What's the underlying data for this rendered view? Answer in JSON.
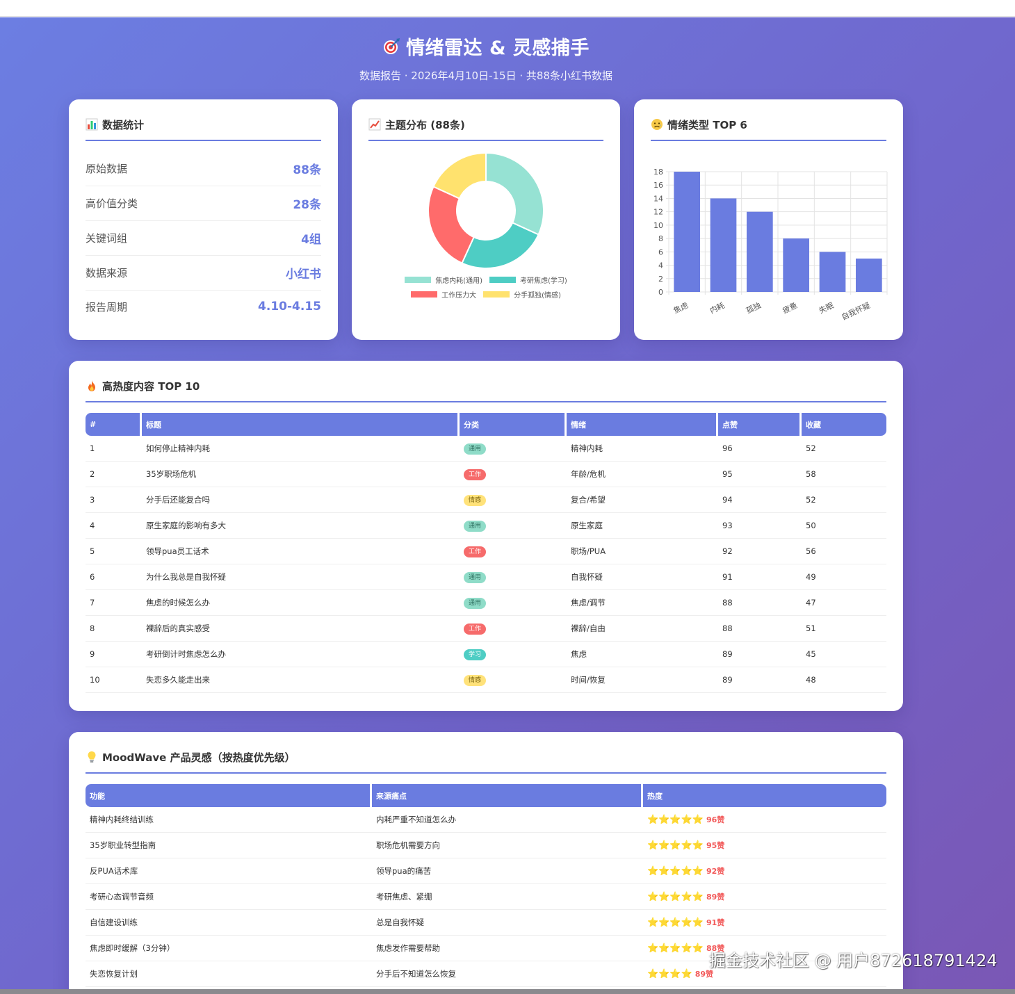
{
  "header": {
    "title": "情绪雷达 & 灵感捕手",
    "subtitle": "数据报告 · 2026年4月10日-15日 · 共88条小红书数据"
  },
  "stats_card": {
    "title": "数据统计",
    "rows": [
      {
        "label": "原始数据",
        "value": "88条"
      },
      {
        "label": "高价值分类",
        "value": "28条"
      },
      {
        "label": "关键词组",
        "value": "4组"
      },
      {
        "label": "数据来源",
        "value": "小红书"
      },
      {
        "label": "报告周期",
        "value": "4.10-4.15"
      }
    ]
  },
  "topic_card": {
    "title": "主题分布 (88条)"
  },
  "emotion_card": {
    "title": "情绪类型 TOP 6"
  },
  "chart_data": [
    {
      "type": "pie",
      "title": "",
      "donut": true,
      "categories": [
        "焦虑内耗(通用)",
        "考研焦虑(学习)",
        "工作压力大",
        "分手孤独(情感)"
      ],
      "values": [
        28,
        22,
        22,
        16
      ],
      "colors": [
        "#96e2d3",
        "#4ecdc4",
        "#ff6b6b",
        "#ffe26e"
      ],
      "legend": "bottom"
    },
    {
      "type": "bar",
      "title": "",
      "categories": [
        "焦虑",
        "内耗",
        "孤独",
        "疲惫",
        "失眠",
        "自我怀疑"
      ],
      "values": [
        18,
        14,
        12,
        8,
        6,
        5
      ],
      "ylim": [
        0,
        18
      ],
      "yticks": [
        0,
        2,
        4,
        6,
        8,
        10,
        12,
        14,
        16,
        18
      ],
      "grid": true,
      "color": "#6a7ce0",
      "xlabel": "",
      "ylabel": ""
    }
  ],
  "hot_card": {
    "title": "高热度内容 TOP 10",
    "columns": [
      "#",
      "标题",
      "分类",
      "情绪",
      "点赞",
      "收藏"
    ],
    "rows": [
      {
        "rank": "1",
        "title": "如何停止精神内耗",
        "cat": "通用",
        "cat_type": "general",
        "emotion": "精神内耗",
        "likes": "96",
        "saves": "52"
      },
      {
        "rank": "2",
        "title": "35岁职场危机",
        "cat": "工作",
        "cat_type": "work",
        "emotion": "年龄/危机",
        "likes": "95",
        "saves": "58"
      },
      {
        "rank": "3",
        "title": "分手后还能复合吗",
        "cat": "情感",
        "cat_type": "emotion",
        "emotion": "复合/希望",
        "likes": "94",
        "saves": "52"
      },
      {
        "rank": "4",
        "title": "原生家庭的影响有多大",
        "cat": "通用",
        "cat_type": "general",
        "emotion": "原生家庭",
        "likes": "93",
        "saves": "50"
      },
      {
        "rank": "5",
        "title": "领导pua员工话术",
        "cat": "工作",
        "cat_type": "work",
        "emotion": "职场/PUA",
        "likes": "92",
        "saves": "56"
      },
      {
        "rank": "6",
        "title": "为什么我总是自我怀疑",
        "cat": "通用",
        "cat_type": "general",
        "emotion": "自我怀疑",
        "likes": "91",
        "saves": "49"
      },
      {
        "rank": "7",
        "title": "焦虑的时候怎么办",
        "cat": "通用",
        "cat_type": "general",
        "emotion": "焦虑/调节",
        "likes": "88",
        "saves": "47"
      },
      {
        "rank": "8",
        "title": "裸辞后的真实感受",
        "cat": "工作",
        "cat_type": "work",
        "emotion": "裸辞/自由",
        "likes": "88",
        "saves": "51"
      },
      {
        "rank": "9",
        "title": "考研倒计时焦虑怎么办",
        "cat": "学习",
        "cat_type": "study",
        "emotion": "焦虑",
        "likes": "89",
        "saves": "45"
      },
      {
        "rank": "10",
        "title": "失恋多久能走出来",
        "cat": "情感",
        "cat_type": "emotion",
        "emotion": "时间/恢复",
        "likes": "89",
        "saves": "48"
      }
    ]
  },
  "idea_card": {
    "title": "MoodWave 产品灵感（按热度优先级）",
    "columns": [
      "功能",
      "来源痛点",
      "热度"
    ],
    "rows": [
      {
        "feature": "精神内耗终结训练",
        "pain": "内耗严重不知道怎么办",
        "stars": "⭐⭐⭐⭐⭐",
        "heat": "96赞"
      },
      {
        "feature": "35岁职业转型指南",
        "pain": "职场危机需要方向",
        "stars": "⭐⭐⭐⭐⭐",
        "heat": "95赞"
      },
      {
        "feature": "反PUA话术库",
        "pain": "领导pua的痛苦",
        "stars": "⭐⭐⭐⭐⭐",
        "heat": "92赞"
      },
      {
        "feature": "考研心态调节音频",
        "pain": "考研焦虑、紧绷",
        "stars": "⭐⭐⭐⭐⭐",
        "heat": "89赞"
      },
      {
        "feature": "自信建设训练",
        "pain": "总是自我怀疑",
        "stars": "⭐⭐⭐⭐⭐",
        "heat": "91赞"
      },
      {
        "feature": "焦虑即时缓解（3分钟）",
        "pain": "焦虑发作需要帮助",
        "stars": "⭐⭐⭐⭐⭐",
        "heat": "88赞"
      },
      {
        "feature": "失恋恢复计划",
        "pain": "分手后不知道怎么恢复",
        "stars": "⭐⭐⭐⭐",
        "heat": "89赞"
      }
    ]
  },
  "watermark": "掘金技术社区 @ 用户872618791424"
}
